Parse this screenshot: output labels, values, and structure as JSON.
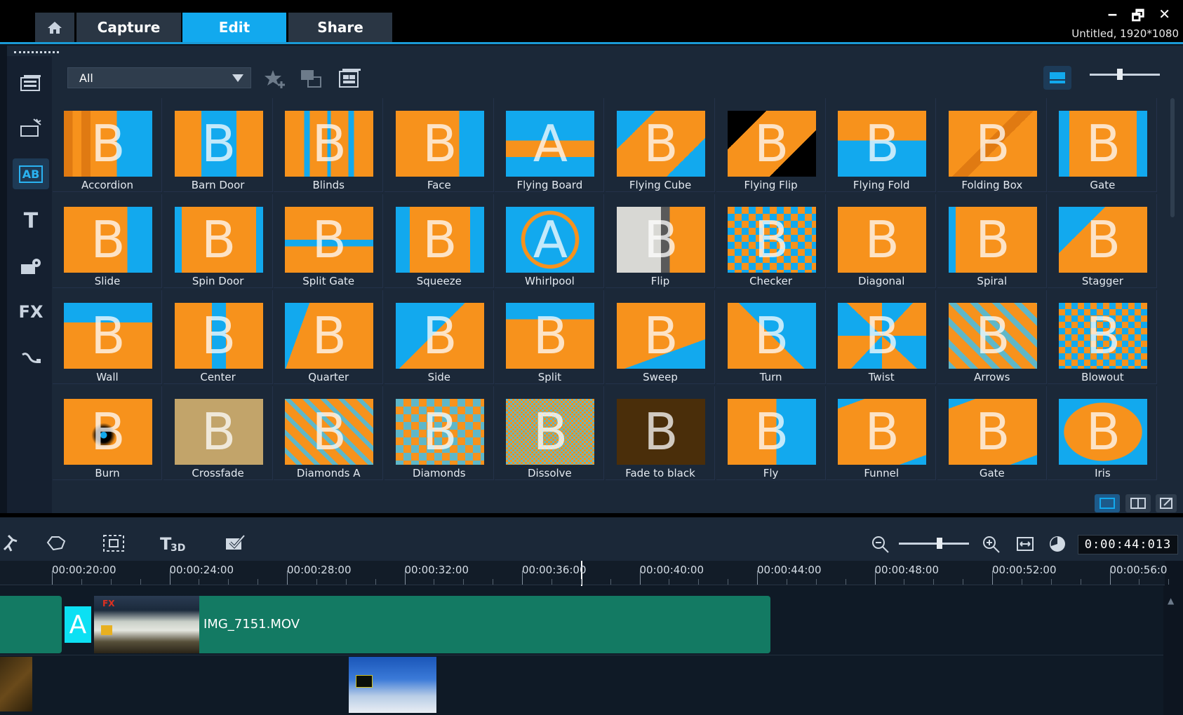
{
  "tabs": {
    "home": "home-icon",
    "capture": "Capture",
    "edit": "Edit",
    "share": "Share"
  },
  "window": {
    "project_info": "Untitled, 1920*1080",
    "minimize": "‒",
    "restore": "🗗",
    "close": "✕"
  },
  "sidebar": {
    "instant_project": "instant-project-icon",
    "transitions_label": "AB",
    "title_label": "T",
    "graphics": "graphics-icon",
    "fx_label": "FX",
    "path": "path-icon"
  },
  "library": {
    "filter_value": "All",
    "items": [
      "Accordion",
      "Barn Door",
      "Blinds",
      "Face",
      "Flying Board",
      "Flying Cube",
      "Flying Flip",
      "Flying Fold",
      "Folding Box",
      "Gate",
      "Slide",
      "Spin Door",
      "Split Gate",
      "Squeeze",
      "Whirlpool",
      "Flip",
      "Checker",
      "Diagonal",
      "Spiral",
      "Stagger",
      "Wall",
      "Center",
      "Quarter",
      "Side",
      "Split",
      "Sweep",
      "Turn",
      "Twist",
      "Arrows",
      "Blowout",
      "Burn",
      "Crossfade",
      "Diamonds A",
      "Diamonds",
      "Dissolve",
      "Fade to black",
      "Fly",
      "Funnel",
      "Gate",
      "Iris"
    ]
  },
  "timeline": {
    "timecode": "0:00:44:013",
    "ruler": [
      "00:00:20:00",
      "00:00:24:00",
      "00:00:28:00",
      "00:00:32:00",
      "00:00:36:00",
      "00:00:40:00",
      "00:00:44:00",
      "00:00:48:00",
      "00:00:52:00",
      "00:00:56:0"
    ],
    "video_clip": "IMG_7151.MOV",
    "transition_glyph": "A",
    "fx_badge": "FX"
  },
  "colors": {
    "accent": "#12a9ee",
    "clip": "#137a63",
    "thumb_orange": "#f7921c",
    "thumb_blue": "#12a9ee"
  }
}
